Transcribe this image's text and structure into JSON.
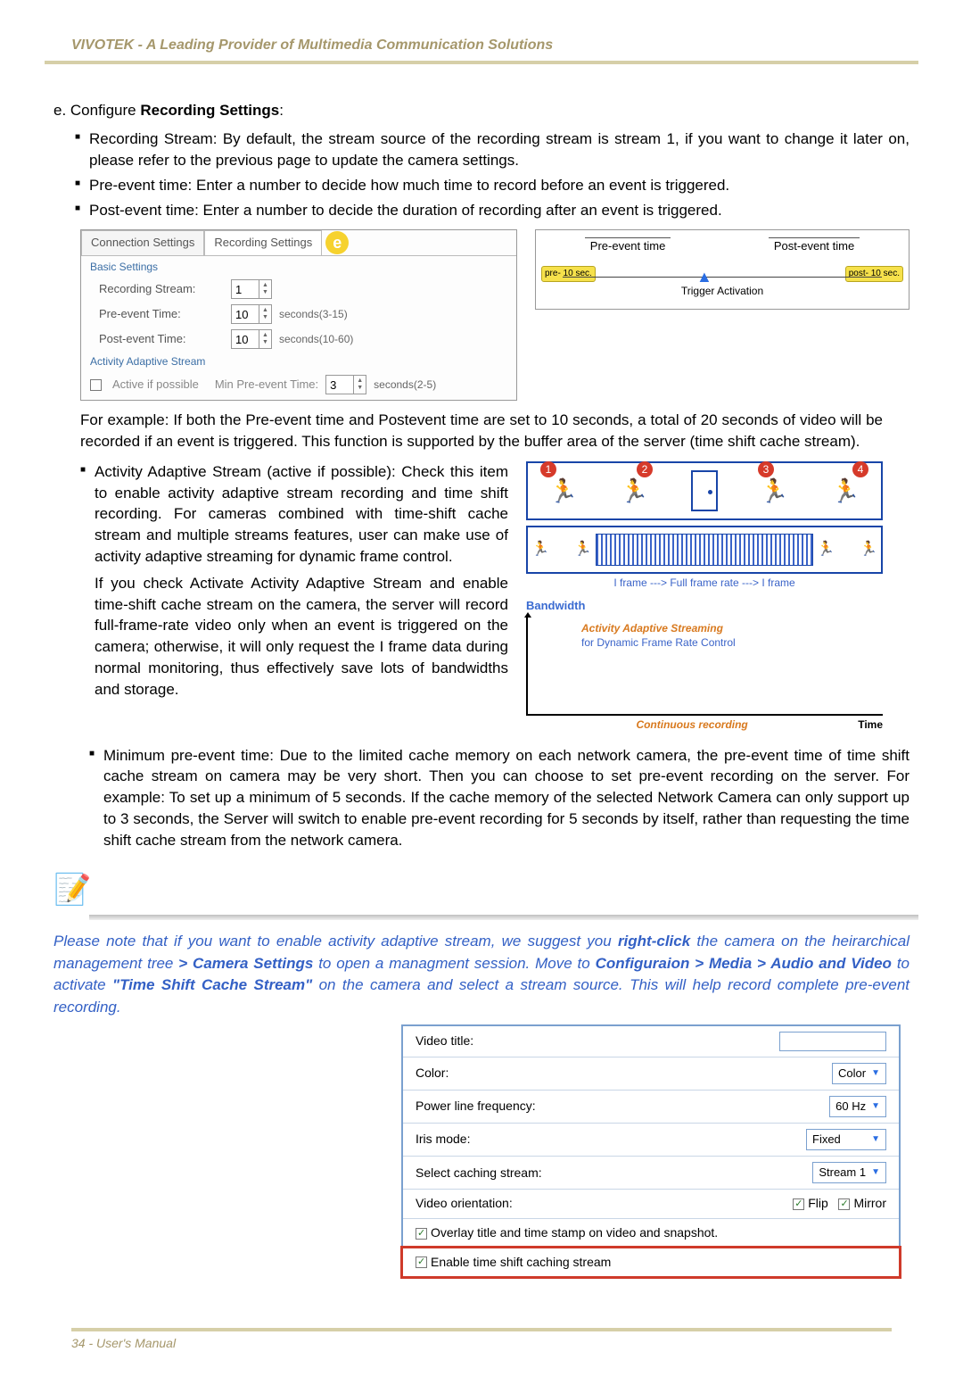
{
  "header": "VIVOTEK - A Leading Provider of Multimedia Communication Solutions",
  "section": {
    "prefix": "e. Configure ",
    "bold": "Recording Settings",
    "suffix": ":"
  },
  "top_bullets": [
    "Recording Stream: By default, the stream source of the recording stream is stream 1, if you want to change it later on, please refer to the previous page to update the camera settings.",
    "Pre-event time: Enter a number to decide how much time to record before an event is triggered.",
    "Post-event time: Enter a number to decide the duration of recording after an event is triggered."
  ],
  "tabs": {
    "conn": "Connection Settings",
    "rec": "Recording Settings"
  },
  "badge": "e",
  "fieldset1": "Basic Settings",
  "rows": {
    "rstream_lbl": "Recording Stream:",
    "rstream_val": "1",
    "pre_lbl": "Pre-event Time:",
    "pre_val": "10",
    "pre_hint": "seconds(3-15)",
    "post_lbl": "Post-event Time:",
    "post_val": "10",
    "post_hint": "seconds(10-60)"
  },
  "fieldset2": "Activity Adaptive Stream",
  "aas": {
    "chk": "Active if possible",
    "min_lbl": "Min Pre-event Time:",
    "min_val": "3",
    "min_hint": "seconds(2-5)"
  },
  "timeline": {
    "pre": "Pre-event time",
    "post": "Post-event time",
    "pill_pre": "pre-\n10 sec.",
    "pill_post": "post-\n10 sec.",
    "trigger": "Trigger Activation"
  },
  "para1": "For example: If both the Pre-event time and Postevent time are set to 10 seconds, a total of 20 seconds of video will be recorded if an event is triggered. This function is supported by the buffer area of the server (time shift cache stream).",
  "aas_bullet": "Activity Adaptive Stream (active if possible): Check this item to enable activity adaptive stream recording and time shift recording. For cameras combined with time-shift cache stream and multiple streams features, user can make use of activity adaptive streaming for dynamic frame control.",
  "aas_para": "If you check Activate Activity Adaptive Stream and enable time-shift cache stream on the camera, the server will record full-frame-rate video only when an event is triggered on the camera; otherwise, it will only request the I frame data during normal monitoring, thus effectively save lots of bandwidths and storage.",
  "diagram": {
    "legend": "I frame   --->   Full frame rate   --->   I frame",
    "bw": "Bandwidth",
    "g1": "Activity Adaptive Streaming",
    "g2": "for Dynamic Frame Rate Control",
    "cr": "Continuous recording",
    "time": "Time"
  },
  "min_bullet": "Minimum pre-event time: Due to the limited cache memory on each network camera, the pre-event time of time shift cache stream on camera may be very short. Then you can choose to set pre-event recording on the server. For example: To set up a minimum of 5 seconds. If the cache memory of the selected Network Camera can only support up to 3 seconds, the Server will switch to enable pre-event recording for 5 seconds by itself, rather than requesting the time shift cache stream from the network camera.",
  "note": {
    "p1a": "Please note that if you want to enable activity adaptive stream, we suggest you ",
    "b1": "right-click",
    "p1b": " the camera on the heirarchical management tree ",
    "b2": "> Camera Settings",
    "p1c": " to open a managment session. Move to ",
    "b3": "Configuraion > Media > Audio and Video",
    "p1d": " to activate ",
    "b4": "\"Time Shift Cache Stream\"",
    "p1e": " on the camera and select a stream source. This will help record complete pre-event recording."
  },
  "cam": {
    "video_title": "Video title:",
    "color_lbl": "Color:",
    "color_val": "Color",
    "plf_lbl": "Power line frequency:",
    "plf_val": "60 Hz",
    "iris_lbl": "Iris mode:",
    "iris_val": "Fixed",
    "scs_lbl": "Select caching stream:",
    "scs_val": "Stream 1",
    "orient_lbl": "Video orientation:",
    "flip": "Flip",
    "mirror": "Mirror",
    "overlay": "Overlay title and time stamp on video and snapshot.",
    "enable": "Enable time shift caching stream"
  },
  "footer": "34 - User's Manual"
}
